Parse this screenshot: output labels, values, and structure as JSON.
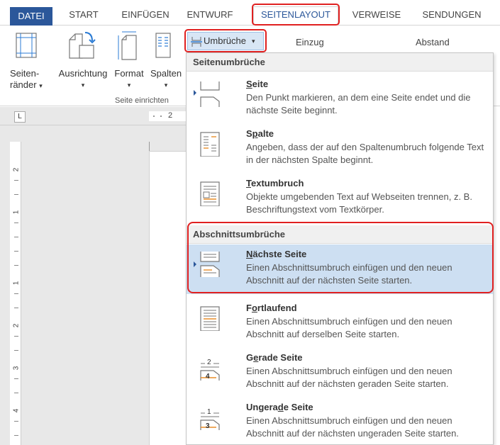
{
  "tabs": [
    {
      "key": "datei",
      "label": "DATEI"
    },
    {
      "key": "start",
      "label": "START"
    },
    {
      "key": "einfuegen",
      "label": "EINFÜGEN"
    },
    {
      "key": "entwurf",
      "label": "ENTWURF"
    },
    {
      "key": "seitenlayout",
      "label": "SEITENLAYOUT"
    },
    {
      "key": "verweise",
      "label": "VERWEISE"
    },
    {
      "key": "sendungen",
      "label": "SENDUNGEN"
    }
  ],
  "ribbon": {
    "seitenraender_line1": "Seiten-",
    "seitenraender_line2": "ränder",
    "ausrichtung": "Ausrichtung",
    "format": "Format",
    "spalten": "Spalten",
    "group_label": "Seite einrichten",
    "umbrueche": "Umbrüche",
    "einzug": "Einzug",
    "abstand": "Abstand",
    "dropdown_arrow": "▾"
  },
  "ruler": {
    "corner": "L",
    "h_number": "2",
    "v_numbers": [
      "2",
      "1",
      "1",
      "2",
      "3",
      "4"
    ]
  },
  "dropdown": {
    "header_page_breaks": "Seitenumbrüche",
    "header_section_breaks": "Abschnittsumbrüche",
    "items": [
      {
        "key": "seite",
        "title_pre": "",
        "title_ul": "S",
        "title_post": "eite",
        "desc": "Den Punkt markieren, an dem eine Seite endet und die nächste Seite beginnt."
      },
      {
        "key": "spalte",
        "title_pre": "S",
        "title_ul": "p",
        "title_post": "alte",
        "desc": "Angeben, dass der auf den Spaltenumbruch folgende Text in der nächsten Spalte beginnt."
      },
      {
        "key": "textumbruch",
        "title_pre": "",
        "title_ul": "T",
        "title_post": "extumbruch",
        "desc": "Objekte umgebenden Text auf Webseiten trennen, z. B. Beschriftungstext vom Textkörper."
      },
      {
        "key": "naechste",
        "title_pre": "",
        "title_ul": "N",
        "title_post": "ächste Seite",
        "desc": "Einen Abschnittsumbruch einfügen und den neuen Abschnitt auf der nächsten Seite starten."
      },
      {
        "key": "fortlaufend",
        "title_pre": "F",
        "title_ul": "o",
        "title_post": "rtlaufend",
        "desc": "Einen Abschnittsumbruch einfügen und den neuen Abschnitt auf derselben Seite starten."
      },
      {
        "key": "gerade",
        "title_pre": "G",
        "title_ul": "e",
        "title_post": "rade Seite",
        "desc": "Einen Abschnittsumbruch einfügen und den neuen Abschnitt auf der nächsten geraden Seite starten."
      },
      {
        "key": "ungerade",
        "title_pre": "Ungera",
        "title_ul": "d",
        "title_post": "e Seite",
        "desc": "Einen Abschnittsumbruch einfügen und den neuen Abschnitt auf der nächsten ungeraden Seite starten."
      }
    ],
    "icon_numbers": {
      "gerade_a": "2",
      "gerade_b": "4",
      "ungerade_a": "1",
      "ungerade_b": "3"
    }
  },
  "colors": {
    "file_tab": "#2b579a",
    "highlight": "#e02020",
    "selected_row": "#cddff2"
  }
}
